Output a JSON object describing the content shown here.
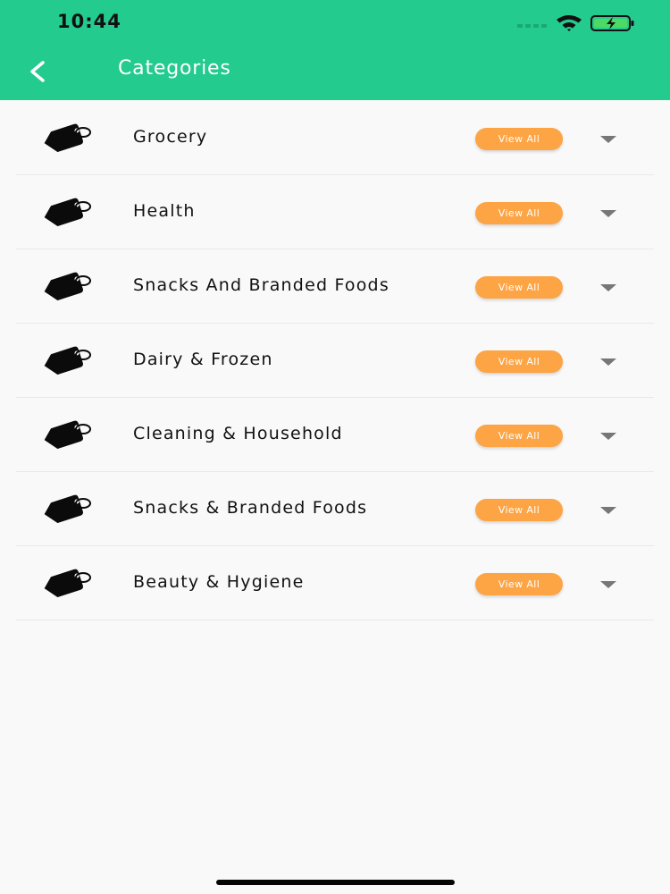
{
  "status_bar": {
    "time": "10:44",
    "icons": [
      "cellular-signal-icon",
      "wifi-icon",
      "battery-charging-icon"
    ]
  },
  "header": {
    "title": "Categories",
    "back_icon": "chevron-left-icon"
  },
  "categories": [
    {
      "label": "Grocery",
      "button": "View All",
      "icon": "tag-icon"
    },
    {
      "label": "Health",
      "button": "View All",
      "icon": "tag-icon"
    },
    {
      "label": "Snacks And Branded Foods",
      "button": "View All",
      "icon": "tag-icon"
    },
    {
      "label": "Dairy & Frozen",
      "button": "View All",
      "icon": "tag-icon"
    },
    {
      "label": "Cleaning & Household",
      "button": "View All",
      "icon": "tag-icon"
    },
    {
      "label": "Snacks & Branded Foods",
      "button": "View All",
      "icon": "tag-icon"
    },
    {
      "label": "Beauty & Hygiene",
      "button": "View All",
      "icon": "tag-icon"
    }
  ],
  "colors": {
    "header_bg": "#23cb8f",
    "button_bg": "#fda444",
    "page_bg": "#f9f9fa"
  }
}
